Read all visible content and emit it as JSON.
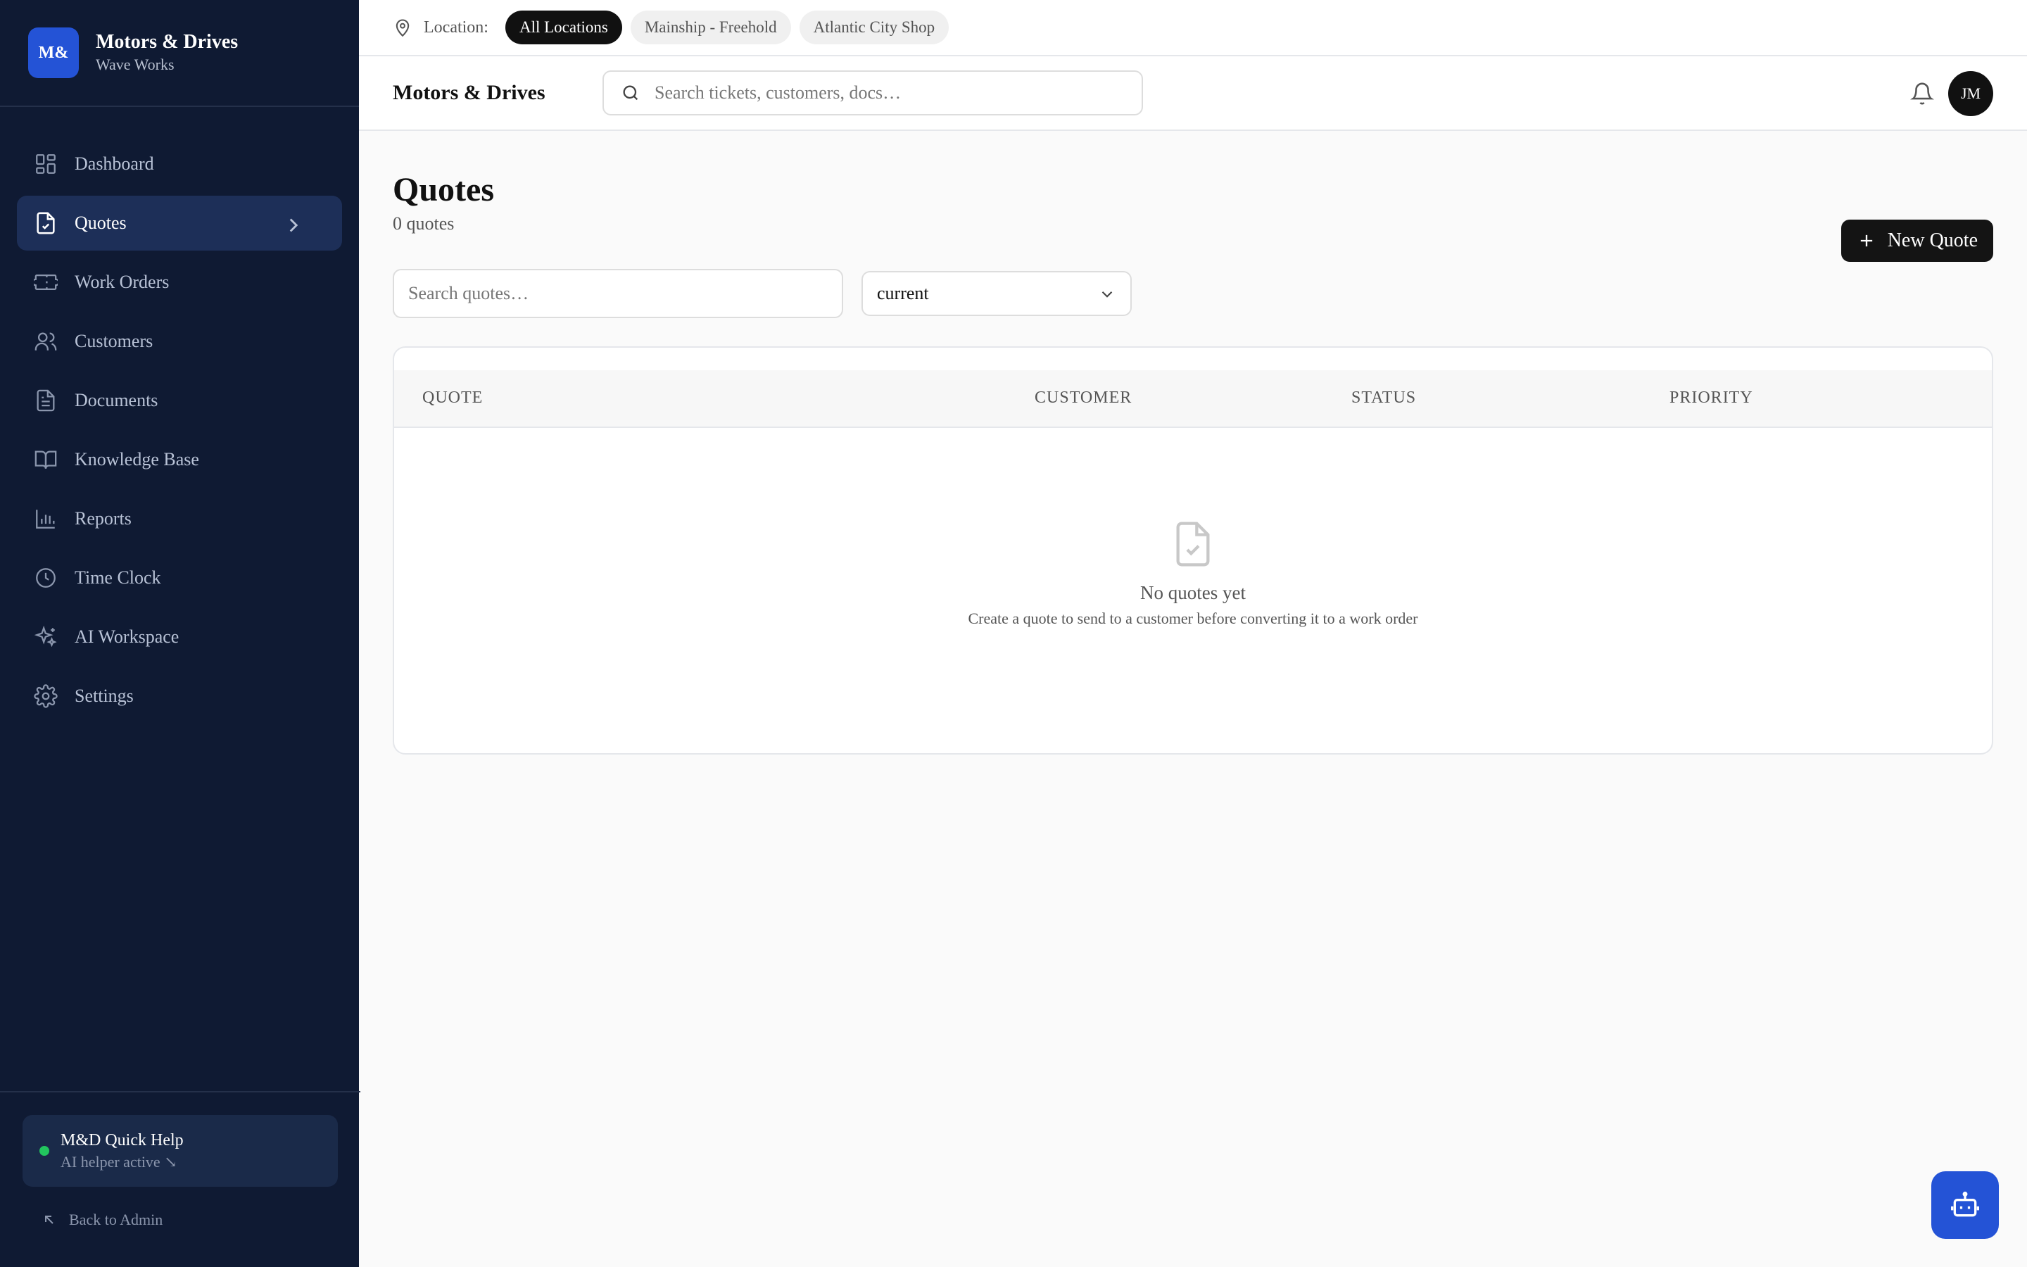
{
  "brand": {
    "logo": "M&",
    "title": "Motors & Drives",
    "subtitle": "Wave Works"
  },
  "sidebar": {
    "items": [
      {
        "label": "Dashboard",
        "icon": "dashboard-icon"
      },
      {
        "label": "Quotes",
        "icon": "quote-icon",
        "active": true
      },
      {
        "label": "Work Orders",
        "icon": "ticket-icon"
      },
      {
        "label": "Customers",
        "icon": "users-icon"
      },
      {
        "label": "Documents",
        "icon": "document-icon"
      },
      {
        "label": "Knowledge Base",
        "icon": "book-icon"
      },
      {
        "label": "Reports",
        "icon": "chart-icon"
      },
      {
        "label": "Time Clock",
        "icon": "clock-icon"
      },
      {
        "label": "AI Workspace",
        "icon": "sparkle-icon"
      },
      {
        "label": "Settings",
        "icon": "gear-icon"
      }
    ]
  },
  "help": {
    "title": "M&D Quick Help",
    "subtitle": "AI helper active ↘"
  },
  "back_admin": "Back to Admin",
  "location": {
    "label": "Location:",
    "chips": [
      {
        "label": "All Locations",
        "active": true
      },
      {
        "label": "Mainship - Freehold"
      },
      {
        "label": "Atlantic City Shop"
      }
    ]
  },
  "header": {
    "title": "Motors & Drives",
    "search_placeholder": "Search tickets, customers, docs…",
    "avatar": "JM"
  },
  "page": {
    "title": "Quotes",
    "count": "0 quotes",
    "new_button": "New Quote",
    "search_placeholder": "Search quotes…",
    "status_filter": "current"
  },
  "table": {
    "columns": [
      "QUOTE",
      "CUSTOMER",
      "STATUS",
      "PRIORITY"
    ],
    "empty_title": "No quotes yet",
    "empty_subtitle": "Create a quote to send to a customer before converting it to a work order"
  },
  "colors": {
    "sidebar_bg": "#0f1a33",
    "active_item": "#1d2f58",
    "accent": "#2453d6",
    "status_green": "#22c55e"
  }
}
